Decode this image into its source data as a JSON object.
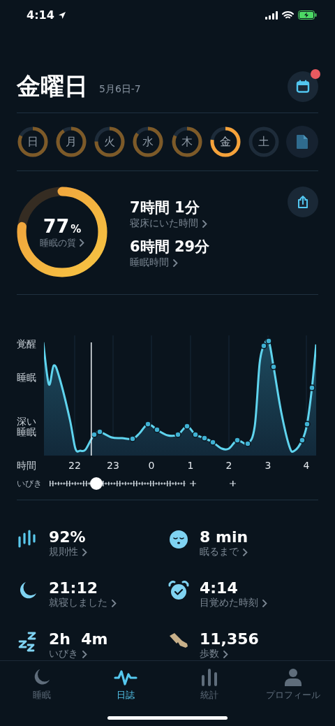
{
  "status_bar": {
    "time": "4:14",
    "charging": true
  },
  "header": {
    "title": "金曜日",
    "date_range": "5月6日-7",
    "calendar_badge": true
  },
  "week": [
    {
      "label": "日",
      "level": 0.82,
      "selected": false
    },
    {
      "label": "月",
      "level": 0.9,
      "selected": false
    },
    {
      "label": "火",
      "level": 0.75,
      "selected": false
    },
    {
      "label": "水",
      "level": 0.85,
      "selected": false
    },
    {
      "label": "木",
      "level": 0.82,
      "selected": false
    },
    {
      "label": "金",
      "level": 0.77,
      "selected": true
    },
    {
      "label": "土",
      "selected": false
    }
  ],
  "summary": {
    "quality": {
      "value": "77",
      "unit": "%",
      "label": "睡眠の質",
      "level": 0.77
    },
    "metrics": [
      {
        "value": "7時間 1分",
        "label": "寝床にいた時間"
      },
      {
        "value": "6時間 29分",
        "label": "睡眠時間"
      }
    ]
  },
  "sleep_graph": {
    "y_labels": [
      "覚醒",
      "睡眠",
      "深い睡眠"
    ],
    "x_title": "時間",
    "x_labels": [
      "22",
      "23",
      "0",
      "1",
      "2",
      "3",
      "4"
    ],
    "snore_label": "いびき"
  },
  "stats": [
    {
      "value": "92%",
      "label": "規則性"
    },
    {
      "value": "8 min",
      "label": "眠るまで"
    },
    {
      "value": "21:12",
      "label": "就寝しました"
    },
    {
      "value": "4:14",
      "label": "目覚めた時刻"
    },
    {
      "value": "2h  4m",
      "label": "いびき"
    },
    {
      "value": "11,356",
      "label": "歩数"
    }
  ],
  "tabs": [
    {
      "label": "睡眠",
      "selected": false
    },
    {
      "label": "日誌",
      "selected": true
    },
    {
      "label": "統計",
      "selected": false
    },
    {
      "label": "プロフィール",
      "selected": false
    }
  ]
}
